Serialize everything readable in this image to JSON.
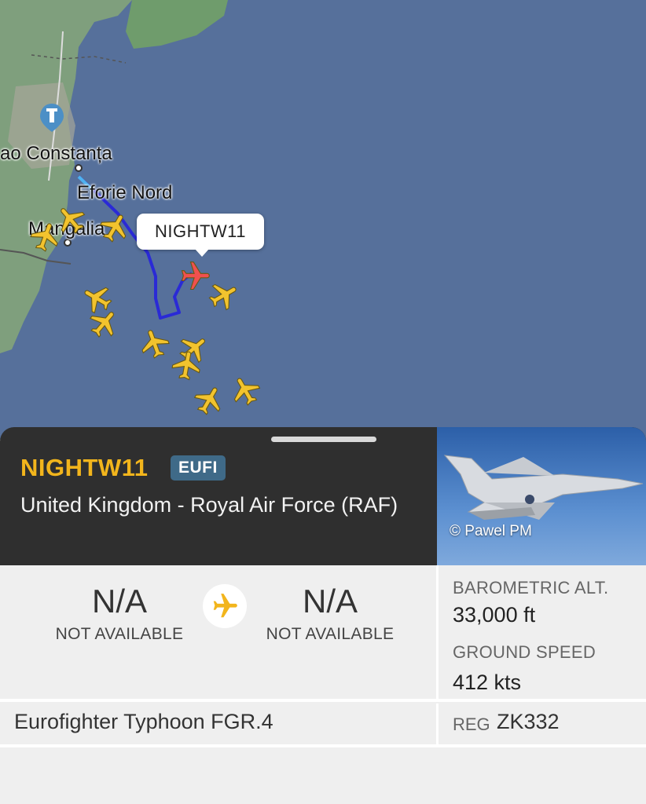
{
  "map": {
    "cities": [
      {
        "name": "Constanța",
        "prefix": "ao"
      },
      {
        "name": "Eforie Nord"
      },
      {
        "name": "Mangalia"
      }
    ],
    "selected_callout": "NIGHTW11",
    "colors": {
      "sea": "#56709b",
      "land": "#7f9f7d",
      "track": "#2a2ad6",
      "traffic": "#f2c32e",
      "selected": "#f0504f"
    }
  },
  "flight": {
    "callsign": "NIGHTW11",
    "type_code": "EUFI",
    "operator": "United Kingdom - Royal Air Force (RAF)",
    "photo_credit": "© Pawel PM",
    "origin": {
      "code": "N/A",
      "label": "NOT AVAILABLE"
    },
    "destination": {
      "code": "N/A",
      "label": "NOT AVAILABLE"
    },
    "route_icon": "plane-icon",
    "barometric_alt_label": "BAROMETRIC ALT.",
    "barometric_alt_value": "33,000 ft",
    "ground_speed_label": "GROUND SPEED",
    "ground_speed_value": "412 kts",
    "aircraft_model": "Eurofighter Typhoon FGR.4",
    "reg_label": "REG",
    "reg_value": "ZK332"
  }
}
